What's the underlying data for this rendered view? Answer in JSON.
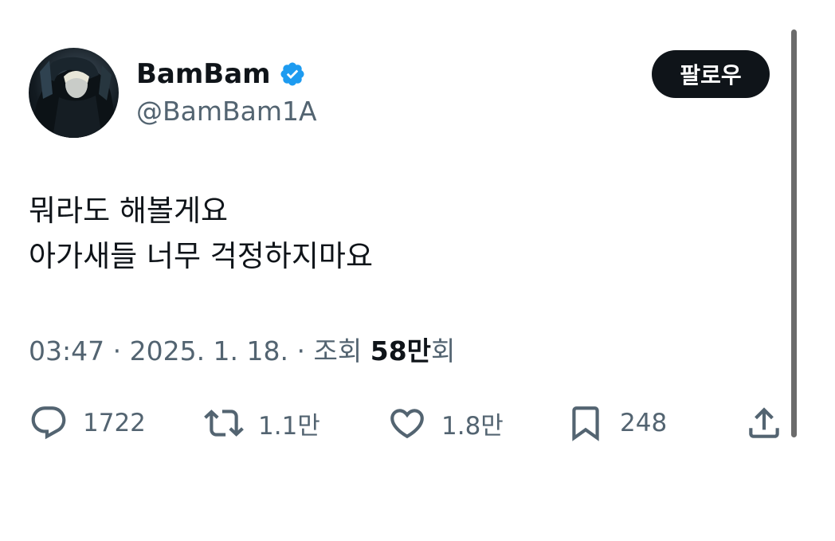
{
  "author": {
    "display_name": "BamBam",
    "handle": "@BamBam1A",
    "verified": true,
    "verified_color": "#1d9bf0"
  },
  "follow_button": {
    "label": "팔로우"
  },
  "tweet": {
    "lines": [
      "뭐라도 해볼게요",
      "아가새들 너무 걱정하지마요"
    ]
  },
  "meta": {
    "time": "03:47",
    "separator": " · ",
    "date": "2025. 1. 18.",
    "views_label": "조회",
    "views_count": "58만",
    "views_suffix": "회"
  },
  "actions": {
    "replies": {
      "icon": "reply-icon",
      "count": "1722"
    },
    "retweets": {
      "icon": "retweet-icon",
      "count": "1.1만"
    },
    "likes": {
      "icon": "heart-icon",
      "count": "1.8만"
    },
    "bookmarks": {
      "icon": "bookmark-icon",
      "count": "248"
    },
    "share": {
      "icon": "share-icon"
    }
  },
  "colors": {
    "text_primary": "#0f1419",
    "text_secondary": "#536471",
    "button_bg": "#0f1419"
  }
}
